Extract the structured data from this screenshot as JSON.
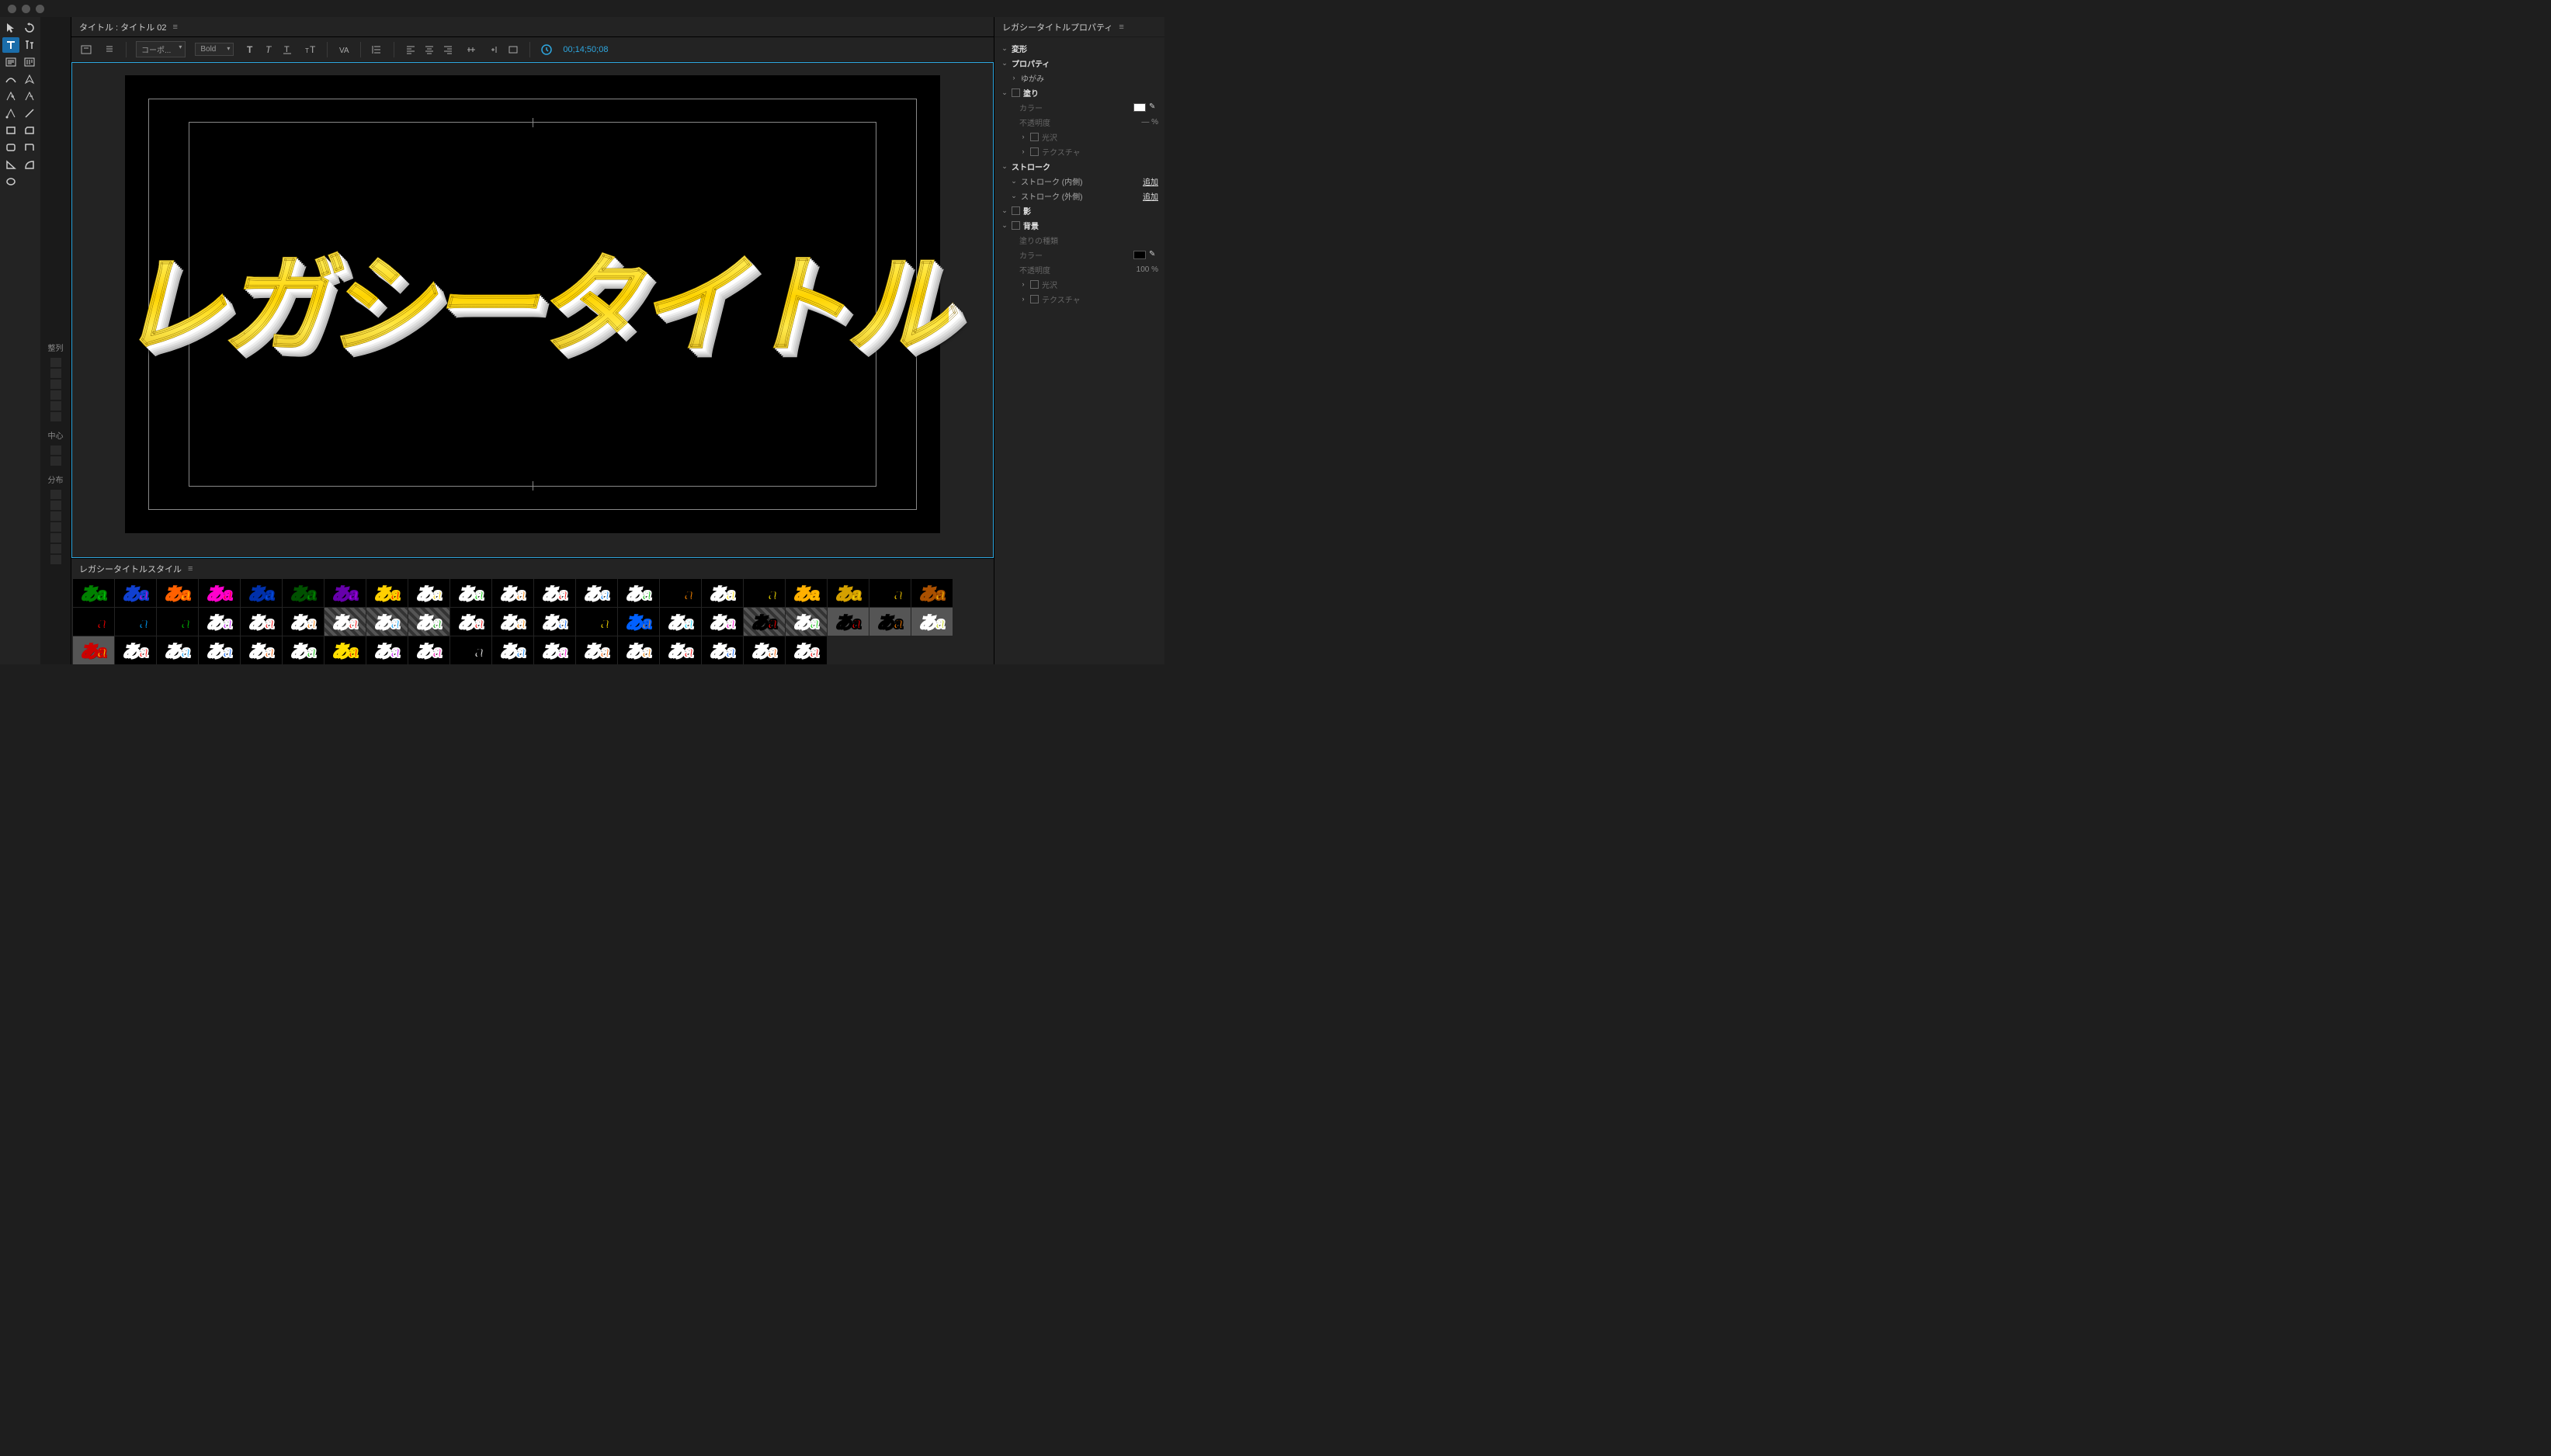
{
  "macControls": true,
  "titleBar": {
    "label": "タイトル : タイトル 02"
  },
  "optionBar": {
    "font": "コーポ...",
    "weight": "Bold",
    "timecode": "00;14;50;08"
  },
  "canvas": {
    "titleText": "レガシータイトル"
  },
  "stylesPanel": {
    "header": "レガシータイトルスタイル",
    "swatchText": "あa",
    "swatches": [
      {
        "fill": "#00e010",
        "stroke": "#008000",
        "bg": "black"
      },
      {
        "fill": "#ff00cc",
        "stroke": "#1040d0",
        "bg": "black"
      },
      {
        "fill": "#ffe000",
        "stroke": "#ff6000",
        "bg": "black"
      },
      {
        "fill": "#ff0000",
        "stroke": "#ff00cc",
        "bg": "black"
      },
      {
        "fill": "#0060ff",
        "stroke": "#0030aa",
        "bg": "black"
      },
      {
        "fill": "#00b000",
        "stroke": "#005000",
        "bg": "black"
      },
      {
        "fill": "#cc00ff",
        "stroke": "#6600aa",
        "bg": "black"
      },
      {
        "fill": "#ff0000",
        "stroke": "#ffd000",
        "bg": "black"
      },
      {
        "fill": "#ffd000",
        "stroke": "#ffffff",
        "bg": "black"
      },
      {
        "fill": "#00d000",
        "stroke": "#ffffff",
        "bg": "black"
      },
      {
        "fill": "#ff8000",
        "stroke": "#ffffff",
        "bg": "black"
      },
      {
        "fill": "#ff0000",
        "stroke": "#ffffff",
        "bg": "black"
      },
      {
        "fill": "#0080ff",
        "stroke": "#ffffff",
        "bg": "black"
      },
      {
        "fill": "#00c000",
        "stroke": "#ffffff",
        "bg": "black"
      },
      {
        "fill": "#ff8800",
        "stroke": "#000000",
        "bg": "black"
      },
      {
        "fill": "#ffe000",
        "stroke": "#ffffff",
        "bg": "black"
      },
      {
        "fill": "#ffe800",
        "stroke": "#000000",
        "bg": "black"
      },
      {
        "fill": "#ffd000",
        "stroke": "#ffb000",
        "bg": "black"
      },
      {
        "fill": "#ffea00",
        "stroke": "#d4a000",
        "bg": "black"
      },
      {
        "fill": "#ffd000",
        "stroke": "#000000",
        "bg": "black"
      },
      {
        "fill": "#ffd000",
        "stroke": "#aa5000",
        "bg": "black"
      },
      {
        "fill": "#ff0000",
        "stroke": "#000000",
        "bg": "black"
      },
      {
        "fill": "#00a0ff",
        "stroke": "#000000",
        "bg": "black"
      },
      {
        "fill": "#00c000",
        "stroke": "#000000",
        "bg": "black"
      },
      {
        "fill": "#c000ff",
        "stroke": "#ffffff",
        "bg": "black"
      },
      {
        "fill": "#ff0000",
        "stroke": "#ffffff",
        "bg": "black"
      },
      {
        "fill": "#ff8000",
        "stroke": "#ffffff",
        "bg": "black"
      },
      {
        "fill": "#ff0000",
        "stroke": "#ffffff",
        "bg": "diamond"
      },
      {
        "fill": "#00a0ff",
        "stroke": "#ffffff",
        "bg": "diamond"
      },
      {
        "fill": "#00a000",
        "stroke": "#ffffff",
        "bg": "diamond"
      },
      {
        "fill": "#ff0000",
        "stroke": "#ffffff",
        "bg": "black"
      },
      {
        "fill": "#ff8800",
        "stroke": "#ffffff",
        "bg": "black"
      },
      {
        "fill": "#0060ff",
        "stroke": "#ffffff",
        "bg": "black"
      },
      {
        "fill": "#ffe000",
        "stroke": "#000000",
        "bg": "black"
      },
      {
        "fill": "#ff8800",
        "stroke": "#0060ff",
        "bg": "black"
      },
      {
        "fill": "#00d0ff",
        "stroke": "#ffffff",
        "bg": "black"
      },
      {
        "fill": "#ff00cc",
        "stroke": "#ffffff",
        "bg": "black"
      },
      {
        "fill": "#ff0000",
        "stroke": "#000000",
        "bg": "diamond"
      },
      {
        "fill": "#00d000",
        "stroke": "#ffffff",
        "bg": "diamond"
      },
      {
        "fill": "#ff0000",
        "stroke": "#000000",
        "bg": "light"
      },
      {
        "fill": "#ff8000",
        "stroke": "#000000",
        "bg": "light"
      },
      {
        "fill": "#c0d000",
        "stroke": "#ffffff",
        "bg": "light"
      },
      {
        "fill": "#ffe000",
        "stroke": "#cc0000",
        "bg": "light"
      },
      {
        "fill": "#ff0000",
        "stroke": "#ffffff",
        "bg": "black"
      },
      {
        "fill": "#00a0ff",
        "stroke": "#ffffff",
        "bg": "black"
      },
      {
        "fill": "#0060ff",
        "stroke": "#ffffff",
        "bg": "black"
      },
      {
        "fill": "#ff6000",
        "stroke": "#ffffff",
        "bg": "black"
      },
      {
        "fill": "#00c000",
        "stroke": "#ffffff",
        "bg": "black"
      },
      {
        "fill": "#ff0000",
        "stroke": "#ffe000",
        "bg": "black"
      },
      {
        "fill": "#cc00ff",
        "stroke": "#ffffff",
        "bg": "black"
      },
      {
        "fill": "#ff00aa",
        "stroke": "#ffffff",
        "bg": "black"
      },
      {
        "fill": "#ffffff",
        "stroke": "#000000",
        "bg": "black"
      },
      {
        "fill": "#0080ff",
        "stroke": "#ffffff",
        "bg": "black"
      },
      {
        "fill": "#ff00cc",
        "stroke": "#ffffff",
        "bg": "black"
      },
      {
        "fill": "#ff6000",
        "stroke": "#ffffff",
        "bg": "black"
      },
      {
        "fill": "#ff8800",
        "stroke": "#ffffff",
        "bg": "black"
      },
      {
        "fill": "#ff0000",
        "stroke": "#ffffff",
        "bg": "black"
      },
      {
        "fill": "#0060ff",
        "stroke": "#ffffff",
        "bg": "black"
      },
      {
        "fill": "#ff6000",
        "stroke": "#ffffff",
        "bg": "black"
      },
      {
        "fill": "#ff0000",
        "stroke": "#ffffff",
        "bg": "black"
      }
    ]
  },
  "propsPanel": {
    "header": "レガシータイトルプロパティ",
    "sections": {
      "transform": "変形",
      "properties": "プロパティ",
      "distort": "ゆがみ",
      "fill": "塗り",
      "color": "カラー",
      "opacity": "不透明度",
      "opacityVal": "— %",
      "sheen": "光沢",
      "texture": "テクスチャ",
      "strokes": "ストローク",
      "strokeInner": "ストローク (内側)",
      "strokeOuter": "ストローク (外側)",
      "add": "追加",
      "shadow": "影",
      "background": "背景",
      "fillType": "塗りの種類",
      "bgOpacityVal": "100 %"
    }
  },
  "alignPanel": {
    "label1": "整列",
    "label2": "中心",
    "label3": "分布"
  }
}
